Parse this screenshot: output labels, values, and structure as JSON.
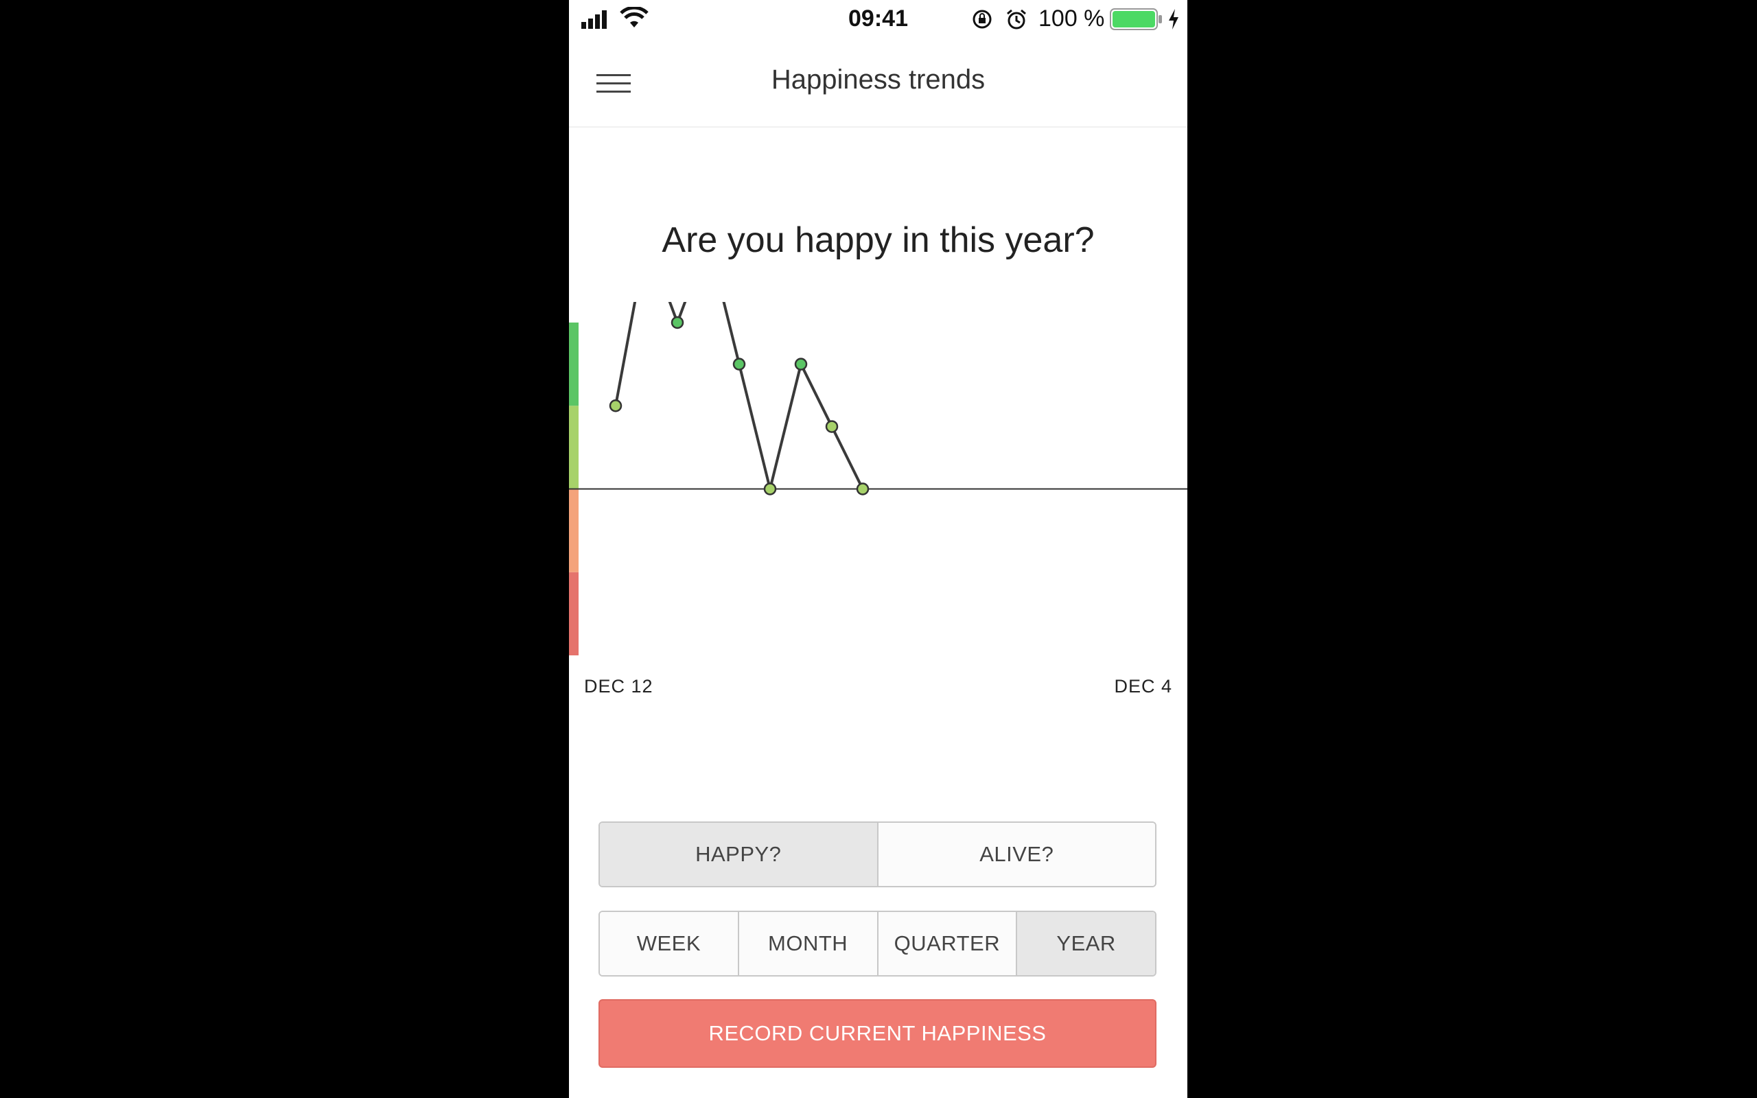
{
  "status_bar": {
    "time": "09:41",
    "battery_percent": "100 %",
    "battery_color": "#4cd964"
  },
  "nav": {
    "title": "Happiness trends",
    "menu_icon": "hamburger-menu-icon"
  },
  "question": "Are you happy in this year?",
  "chart_data": {
    "type": "line",
    "x_start_label": "DEC 12",
    "x_end_label": "DEC 4",
    "y_range": [
      -4,
      4
    ],
    "baseline": 0,
    "values": [
      2,
      6,
      4,
      6,
      3,
      0,
      3,
      1.5,
      0
    ],
    "scale_colors": [
      "#e5736c",
      "#f4a37b",
      "#a7d26a",
      "#5bc565"
    ],
    "line_color": "#3a3a3a",
    "point_colors": {
      "high": "#5bc565",
      "mid": "#a7d26a"
    }
  },
  "metric_toggle": {
    "options": [
      "HAPPY?",
      "ALIVE?"
    ],
    "selected": "HAPPY?"
  },
  "period_toggle": {
    "options": [
      "WEEK",
      "MONTH",
      "QUARTER",
      "YEAR"
    ],
    "selected": "YEAR"
  },
  "record_button": {
    "label": "RECORD CURRENT HAPPINESS",
    "color": "#f07b72"
  }
}
